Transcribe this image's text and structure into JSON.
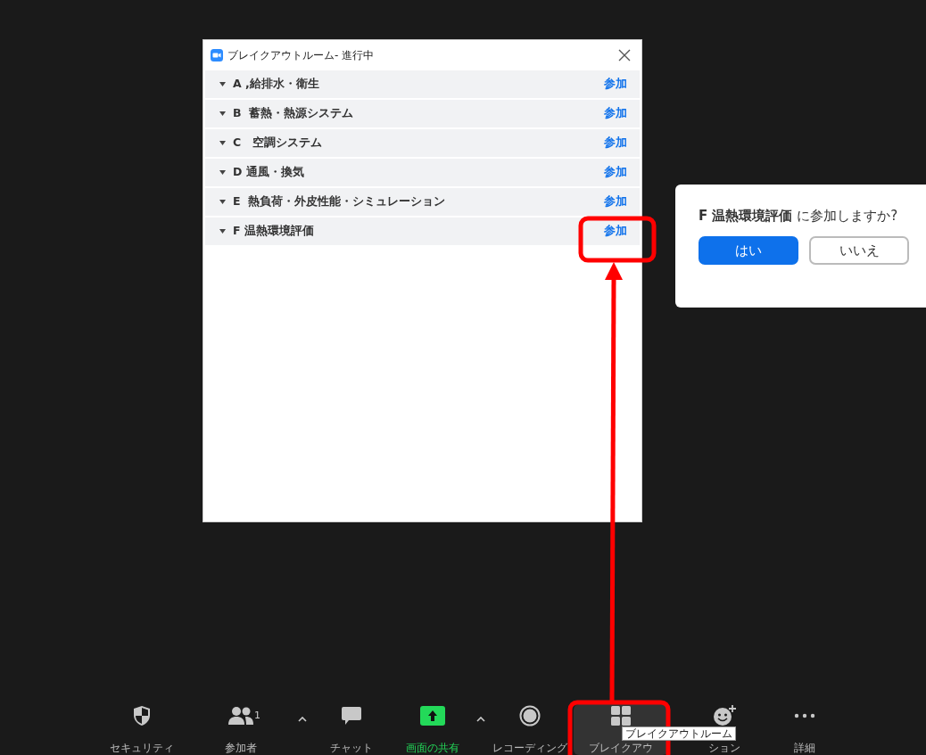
{
  "dialog": {
    "title": "ブレイクアウトルーム- 進行中",
    "rooms": [
      {
        "name": "A ,給排水・衛生",
        "join": "参加"
      },
      {
        "name": "B  蓄熱・熱源システム",
        "join": "参加"
      },
      {
        "name": "C   空調システム",
        "join": "参加"
      },
      {
        "name": "D 通風・換気",
        "join": "参加"
      },
      {
        "name": "E  熱負荷・外皮性能・シミュレーション",
        "join": "参加"
      },
      {
        "name": "F 温熱環境評価",
        "join": "参加"
      }
    ]
  },
  "popover": {
    "message": "**F 温熱環境評価** に参加しますか?",
    "buttons": [
      {
        "label": "はい",
        "kind": "primary"
      },
      {
        "label": "いいえ",
        "kind": "secondary"
      }
    ]
  },
  "toolbar": {
    "items": [
      {
        "kind": "security",
        "label": "セキュリティ",
        "selected": false,
        "active": false
      },
      {
        "kind": "participants",
        "label": "参加者",
        "count": "1",
        "caret": true,
        "selected": false,
        "active": false
      },
      {
        "kind": "chat",
        "label": "チャット",
        "selected": false,
        "active": false
      },
      {
        "kind": "share",
        "label": "画面の共有",
        "caret": true,
        "selected": false,
        "active": true
      },
      {
        "kind": "record",
        "label": "レコーディング",
        "selected": false,
        "active": false
      },
      {
        "kind": "breakout",
        "label": "ブレイクアウ",
        "selected": true,
        "active": false
      },
      {
        "kind": "reactions",
        "label": "ション",
        "selected": false,
        "active": false
      },
      {
        "kind": "more",
        "label": "詳細",
        "selected": false,
        "active": false
      }
    ],
    "tooltip": "ブレイクアウトルーム"
  }
}
